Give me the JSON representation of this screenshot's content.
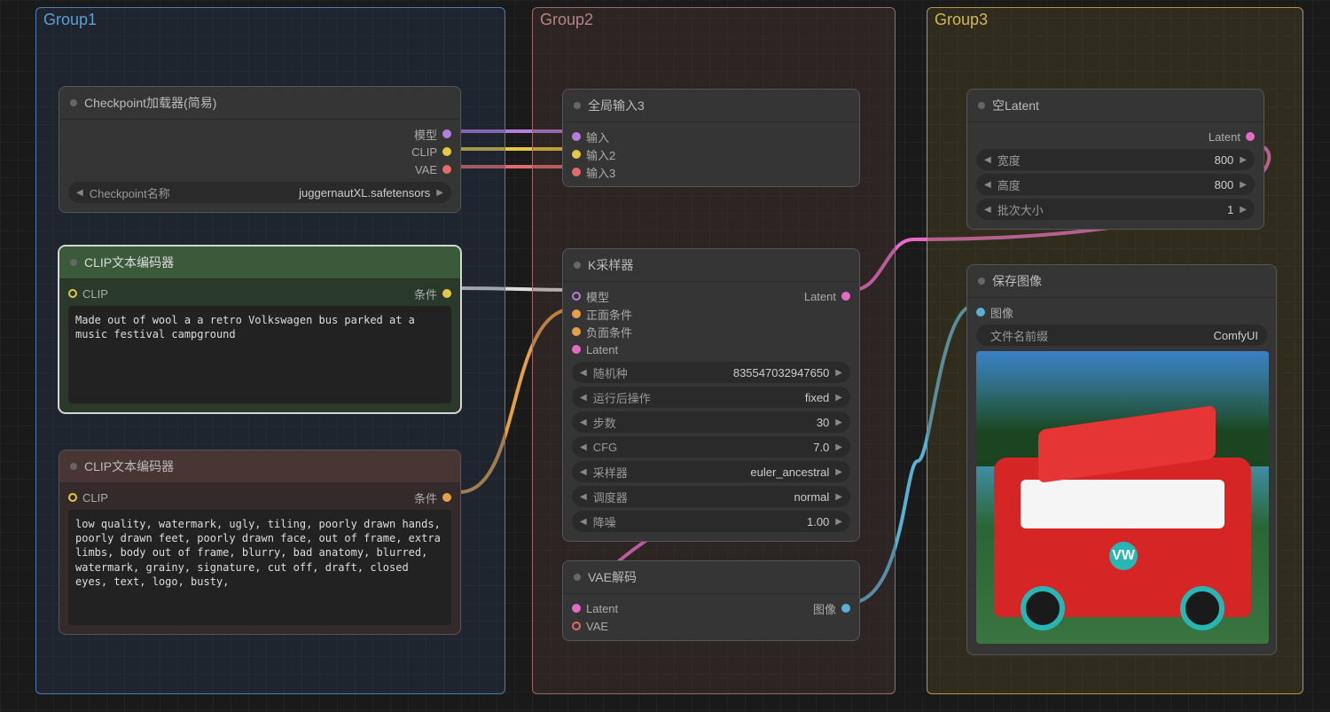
{
  "groups": {
    "g1": "Group1",
    "g2": "Group2",
    "g3": "Group3"
  },
  "checkpoint": {
    "title": "Checkpoint加载器(简易)",
    "out_model": "模型",
    "out_clip": "CLIP",
    "out_vae": "VAE",
    "ckpt_label": "Checkpoint名称",
    "ckpt_value": "juggernautXL.safetensors"
  },
  "clip_pos": {
    "title": "CLIP文本编码器",
    "in": "CLIP",
    "out": "条件",
    "text": "Made out of wool a a retro Volkswagen bus parked at a music festival campground"
  },
  "clip_neg": {
    "title": "CLIP文本编码器",
    "in": "CLIP",
    "out": "条件",
    "text": "low quality, watermark, ugly, tiling, poorly drawn hands, poorly drawn feet, poorly drawn face, out of frame, extra limbs, body out of frame, blurry, bad anatomy, blurred, watermark, grainy, signature, cut off, draft, closed eyes, text, logo, busty,"
  },
  "reroute": {
    "title": "全局输入3",
    "in1": "输入",
    "in2": "输入2",
    "in3": "输入3"
  },
  "ksampler": {
    "title": "K采样器",
    "in_model": "模型",
    "in_pos": "正面条件",
    "in_neg": "负面条件",
    "in_latent": "Latent",
    "out": "Latent",
    "seed_l": "随机种",
    "seed_v": "835547032947650",
    "ctrl_l": "运行后操作",
    "ctrl_v": "fixed",
    "steps_l": "步数",
    "steps_v": "30",
    "cfg_l": "CFG",
    "cfg_v": "7.0",
    "sampler_l": "采样器",
    "sampler_v": "euler_ancestral",
    "sched_l": "调度器",
    "sched_v": "normal",
    "denoise_l": "降噪",
    "denoise_v": "1.00"
  },
  "vae_decode": {
    "title": "VAE解码",
    "in_latent": "Latent",
    "in_vae": "VAE",
    "out": "图像"
  },
  "empty_latent": {
    "title": "空Latent",
    "out": "Latent",
    "w_l": "宽度",
    "w_v": "800",
    "h_l": "高度",
    "h_v": "800",
    "b_l": "批次大小",
    "b_v": "1"
  },
  "save": {
    "title": "保存图像",
    "in": "图像",
    "prefix_l": "文件名前缀",
    "prefix_v": "ComfyUI"
  },
  "ui": {
    "tri_l": "◀",
    "tri_r": "▶"
  }
}
